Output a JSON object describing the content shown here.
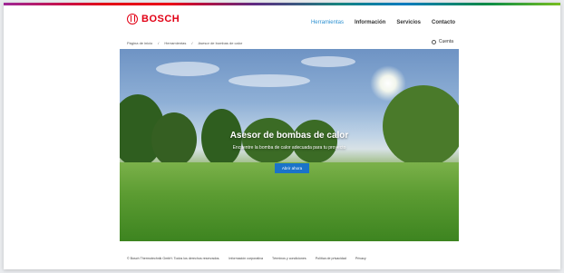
{
  "brand": {
    "name": "BOSCH",
    "accent": "#e20015"
  },
  "nav": {
    "items": [
      "Herramientas",
      "Información",
      "Servicios",
      "Contacto"
    ],
    "active": 0,
    "active_color": "#2a8fd0"
  },
  "breadcrumb": [
    "Página de inicio",
    "Herramientas",
    "Asesor de bombas de calor"
  ],
  "account": {
    "label": "Cuenta",
    "icon": "user-icon"
  },
  "hero": {
    "title": "Asesor de bombas de calor",
    "subtitle": "Encuentre la bomba de calor adecuada para tu proyecto",
    "button": "Abrir ahora",
    "button_color": "#1a73c9"
  },
  "footer": {
    "copyright": "© Bosch Thermotechnik GmbH. Todos los derechos reservados.",
    "links": [
      "Información corporativa",
      "Términos y condiciones",
      "Política de privacidad",
      "Privacy"
    ]
  }
}
